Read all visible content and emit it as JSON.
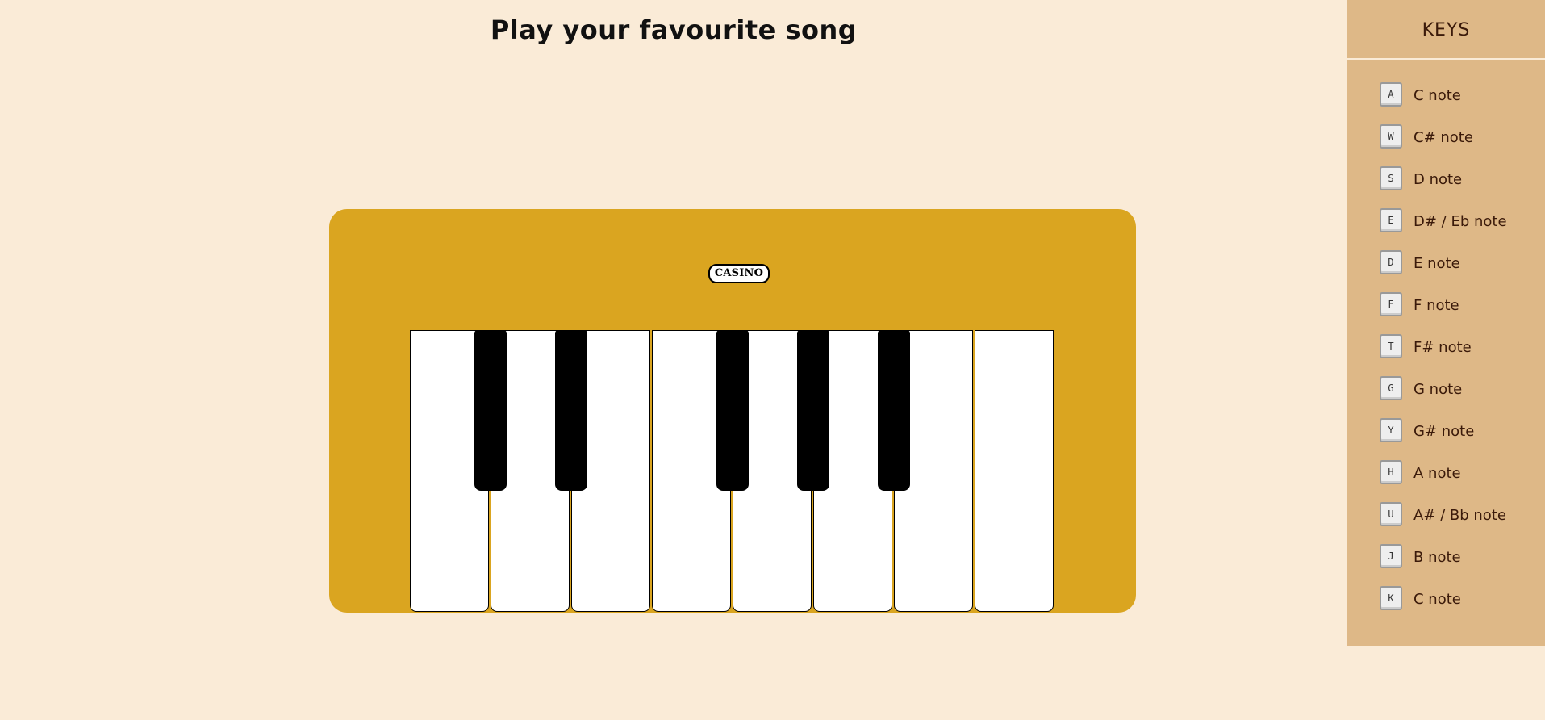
{
  "header": {
    "title": "Play your favourite song"
  },
  "piano": {
    "brand": "CASINO",
    "white_keys": [
      "C",
      "D",
      "E",
      "F",
      "G",
      "A",
      "B",
      "C"
    ],
    "black_keys": [
      "C#",
      "D#",
      "F#",
      "G#",
      "A#"
    ]
  },
  "sidebar": {
    "title": "KEYS",
    "items": [
      {
        "key": "A",
        "label": "C note"
      },
      {
        "key": "W",
        "label": "C# note"
      },
      {
        "key": "S",
        "label": "D note"
      },
      {
        "key": "E",
        "label": "D# / Eb note"
      },
      {
        "key": "D",
        "label": "E note"
      },
      {
        "key": "F",
        "label": "F note"
      },
      {
        "key": "T",
        "label": "F# note"
      },
      {
        "key": "G",
        "label": "G note"
      },
      {
        "key": "Y",
        "label": "G# note"
      },
      {
        "key": "H",
        "label": "A note"
      },
      {
        "key": "U",
        "label": "A# / Bb note"
      },
      {
        "key": "J",
        "label": "B note"
      },
      {
        "key": "K",
        "label": "C note"
      }
    ]
  },
  "colors": {
    "page_background": "#faebd7",
    "piano_body": "#daa520",
    "sidebar_background": "#deb887",
    "white_key": "#ffffff",
    "black_key": "#000000"
  }
}
